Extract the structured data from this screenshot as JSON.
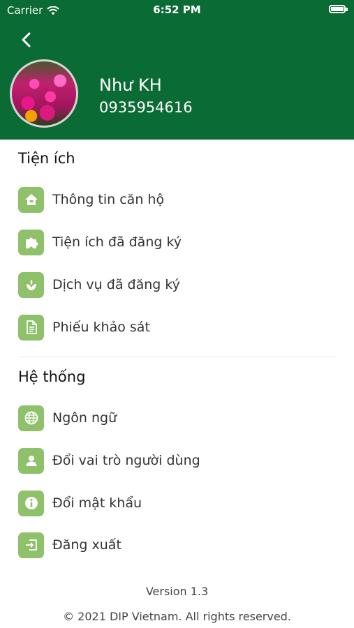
{
  "statusbar": {
    "carrier": "Carrier",
    "time": "6:52 PM"
  },
  "profile": {
    "name": "Như KH",
    "phone": "0935954616"
  },
  "sections": [
    {
      "title": "Tiện ích",
      "items": [
        {
          "label": "Thông tin căn hộ",
          "icon": "home-icon"
        },
        {
          "label": "Tiện ích đã đăng ký",
          "icon": "puzzle-icon"
        },
        {
          "label": "Dịch vụ đã đăng ký",
          "icon": "service-icon"
        },
        {
          "label": "Phiếu khảo sát",
          "icon": "document-icon"
        }
      ]
    },
    {
      "title": "Hệ thống",
      "items": [
        {
          "label": "Ngôn ngữ",
          "icon": "globe-icon"
        },
        {
          "label": "Đổi vai trò người dùng",
          "icon": "user-icon"
        },
        {
          "label": "Đổi mật khẩu",
          "icon": "info-icon"
        },
        {
          "label": "Đăng xuất",
          "icon": "logout-icon"
        }
      ]
    }
  ],
  "footer": {
    "version": "Version 1.3",
    "copyright": "© 2021 DIP Vietnam. All rights reserved."
  },
  "colors": {
    "header": "#0b6b34",
    "icon_bg": "#8fc06a"
  }
}
